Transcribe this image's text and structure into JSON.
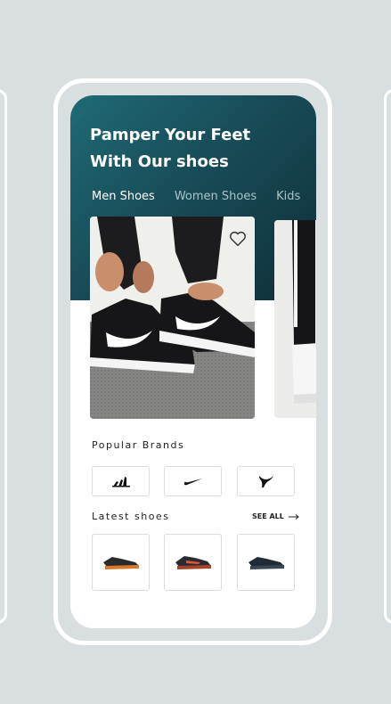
{
  "hero": {
    "title_line1": "Pamper Your Feet",
    "title_line2": "With Our shoes"
  },
  "tabs": [
    {
      "label": "Men Shoes",
      "active": true
    },
    {
      "label": "Women Shoes",
      "active": false
    },
    {
      "label": "Kids",
      "active": false
    }
  ],
  "sections": {
    "popular_brands": "Popular Brands",
    "latest_shoes": "Latest shoes",
    "see_all": "SEE ALL"
  },
  "brands": [
    {
      "name": "adidas-logo"
    },
    {
      "name": "nike-logo"
    },
    {
      "name": "puma-logo"
    }
  ],
  "icons": {
    "favorite": "heart-icon",
    "arrow": "arrow-right-icon"
  },
  "colors": {
    "background": "#d9dfe0",
    "hero_gradient_start": "#1f6a75",
    "hero_gradient_end": "#0f2f38"
  }
}
